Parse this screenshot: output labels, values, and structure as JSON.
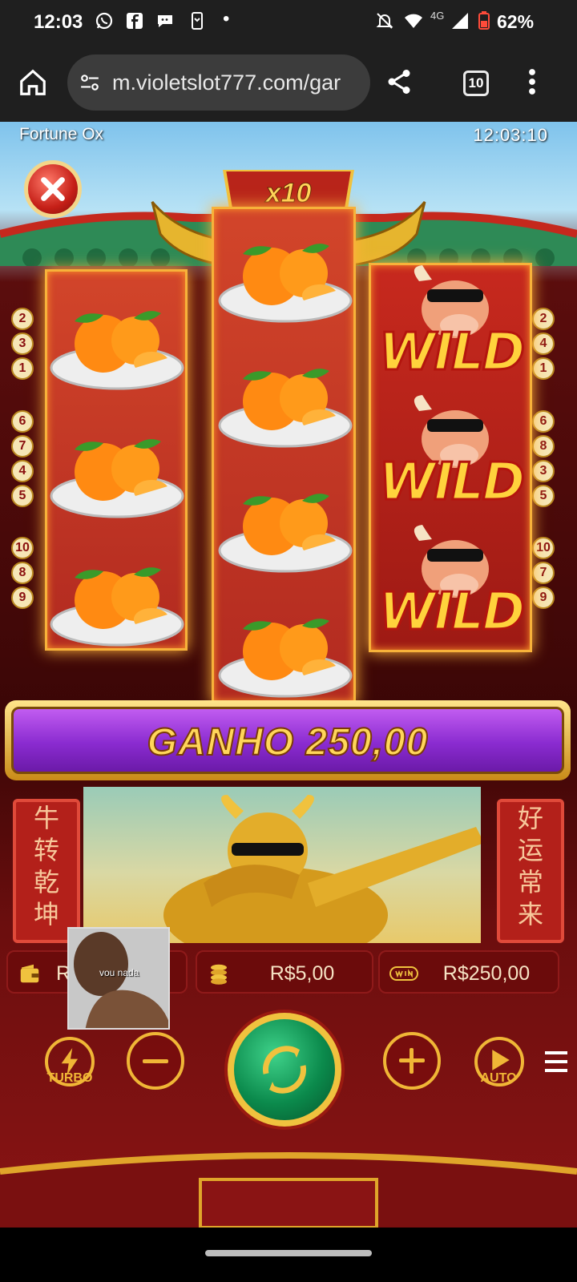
{
  "status_bar": {
    "time": "12:03",
    "network": "4G",
    "battery": "62%",
    "dot": "•",
    "icons": [
      "whatsapp-icon",
      "facebook-icon",
      "chat-icon",
      "phone-link-icon",
      "mute-icon",
      "wifi-icon",
      "signal-icon",
      "battery-icon"
    ]
  },
  "browser": {
    "url": "m.violetslot777.com/gar",
    "tab_count": "10",
    "icons": [
      "home-icon",
      "site-settings-icon",
      "share-icon",
      "tabs-icon",
      "more-vert-icon"
    ]
  },
  "game": {
    "title": "Fortune Ox",
    "clock": "12:03:10",
    "multiplier": "x10",
    "reels": {
      "left": [
        "tangerine",
        "tangerine",
        "tangerine"
      ],
      "middle": [
        "tangerine",
        "tangerine",
        "tangerine",
        "tangerine"
      ],
      "right": [
        "wild",
        "wild",
        "wild"
      ]
    },
    "wild_label": "WILD",
    "paylines_left": [
      [
        "2",
        "3",
        "1"
      ],
      [
        "6",
        "7",
        "4",
        "5"
      ],
      [
        "10",
        "8",
        "9"
      ]
    ],
    "paylines_right": [
      [
        "2",
        "4",
        "1"
      ],
      [
        "6",
        "8",
        "3",
        "5"
      ],
      [
        "10",
        "7",
        "9"
      ]
    ],
    "win_banner": "GANHO 250,00",
    "banner_left": [
      "牛",
      "转",
      "乾",
      "坤"
    ],
    "banner_right": [
      "好",
      "运",
      "常",
      "来"
    ],
    "balance_label": "R",
    "bet_value": "R$5,00",
    "win_value": "R$250,00",
    "webcam_caption": "vou nada",
    "controls": {
      "turbo_label": "TURBO",
      "auto_label": "AUTO"
    },
    "colors": {
      "accent_gold": "#f0b636",
      "win_purple": "#8a2bd0",
      "spin_green": "#0b8a4c",
      "background_red": "#6b0e0e"
    }
  }
}
